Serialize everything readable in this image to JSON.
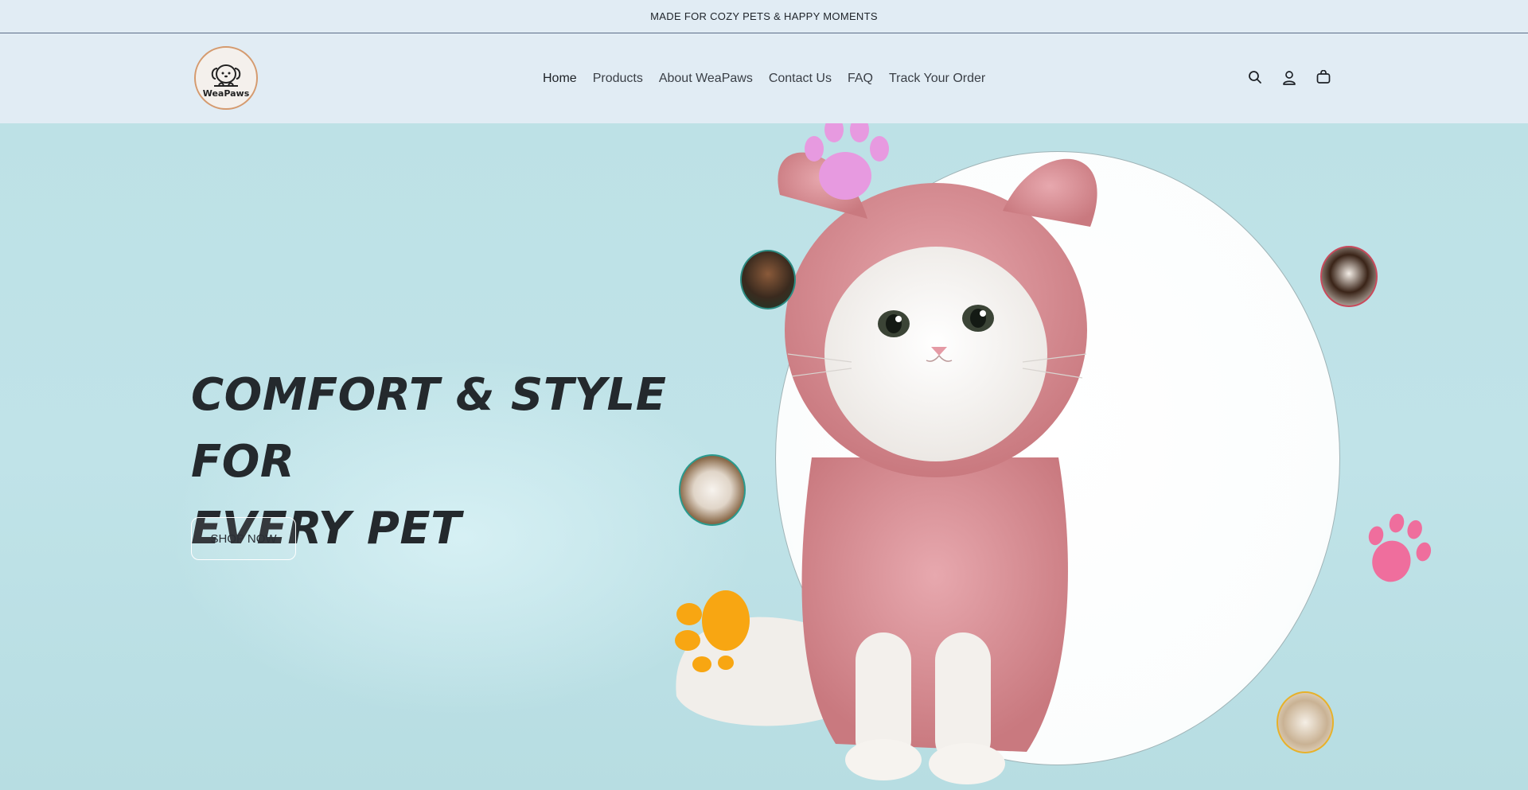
{
  "announcement": {
    "text": "MADE FOR COZY PETS & HAPPY MOMENTS"
  },
  "brand": {
    "name": "WeaPaws",
    "logo_icon": "puppy-logo-icon",
    "ring_color": "#d59a6e"
  },
  "nav": {
    "items": [
      {
        "label": "Home"
      },
      {
        "label": "Products"
      },
      {
        "label": "About WeaPaws"
      },
      {
        "label": "Contact Us"
      },
      {
        "label": "FAQ"
      },
      {
        "label": "Track Your Order"
      }
    ]
  },
  "header_icons": [
    "search-icon",
    "account-icon",
    "cart-icon"
  ],
  "hero": {
    "headline_line1": "COMFORT & STYLE FOR",
    "headline_line2": "EVERY PET",
    "cta_label": "SHOP NOW",
    "image": "kitten-in-pink-bunny-hoodie",
    "accent_colors": {
      "pink_paw": "#e79ae0",
      "hot_pink_paw": "#ef6e9d",
      "orange_paw": "#f8a612",
      "background": "#bfe2e7"
    }
  }
}
